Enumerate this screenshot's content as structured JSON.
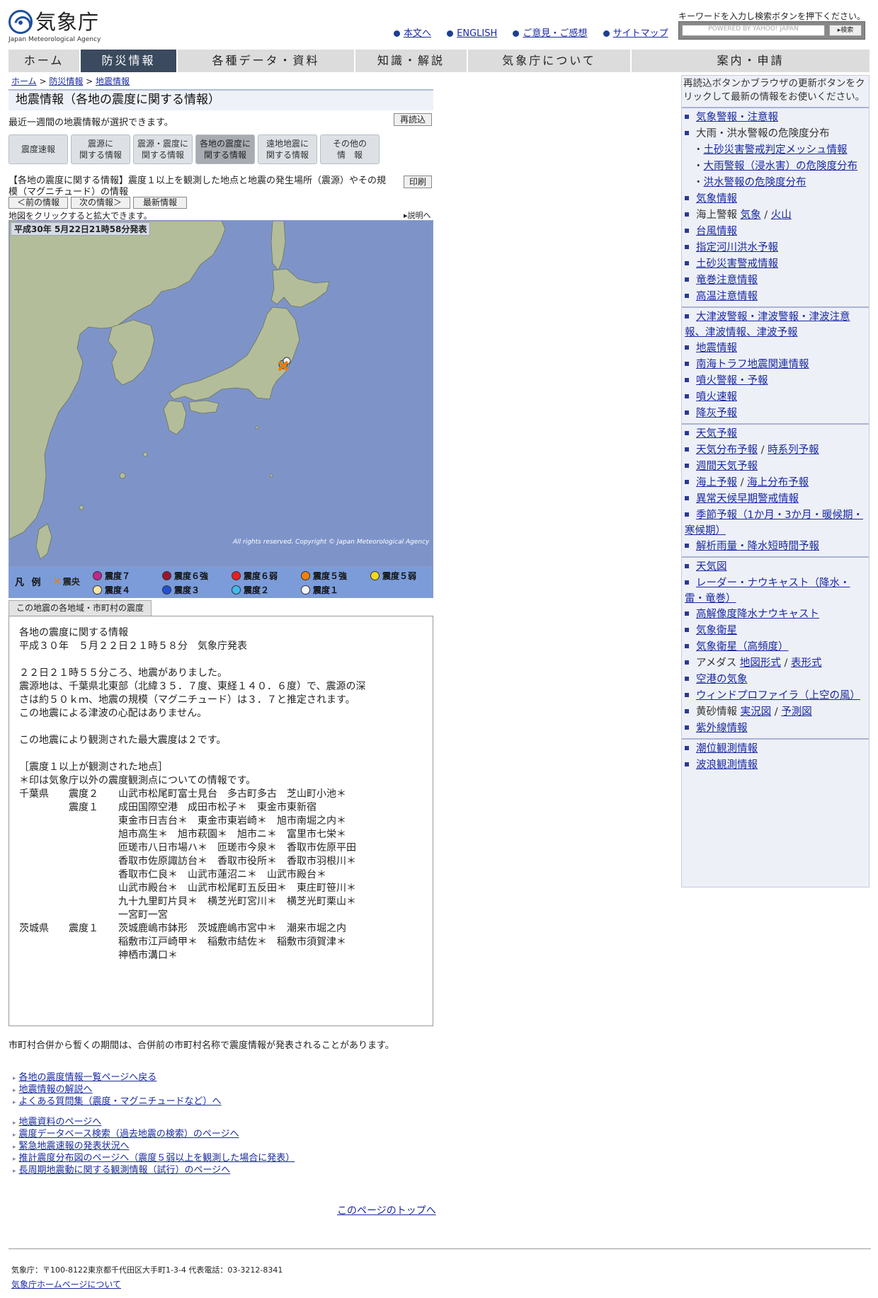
{
  "header": {
    "logo_jp": "気象庁",
    "logo_en": "Japan Meteorological Agency",
    "top_links": [
      "本文へ",
      "ENGLISH",
      "ご意見・ご感想",
      "サイトマップ"
    ],
    "search_hint": "キーワードを入力し検索ボタンを押下ください。",
    "search_placeholder": "POWERED BY YAHOO! JAPAN",
    "search_button": "検索"
  },
  "nav": {
    "tabs": [
      "ホーム",
      "防災情報",
      "各種データ・資料",
      "知識・解説",
      "気象庁について",
      "案内・申請"
    ],
    "active": 1
  },
  "breadcrumb": [
    "ホーム",
    "防災情報",
    "地震情報"
  ],
  "main": {
    "title": "地震情報（各地の震度に関する情報）",
    "lead": "最近一週間の地震情報が選択できます。",
    "reload": "再読込",
    "category_tabs": [
      {
        "l1": "震度速報",
        "l2": ""
      },
      {
        "l1": "震源に",
        "l2": "関する情報"
      },
      {
        "l1": "震源・震度に",
        "l2": "関する情報"
      },
      {
        "l1": "各地の震度に",
        "l2": "関する情報"
      },
      {
        "l1": "遠地地震に",
        "l2": "関する情報"
      },
      {
        "l1": "その他の",
        "l2": "情　報"
      }
    ],
    "info_desc": "【各地の震度に関する情報】震度１以上を観測した地点と地震の発生場所（震源）やその規模（マグニチュード）の情報",
    "print": "印刷",
    "prev": "＜前の情報",
    "next": "次の情報＞",
    "latest": "最新情報",
    "map_hint": "地図をクリックすると拡大できます。",
    "explain": "説明へ",
    "map_date": "平成30年  5月22日21時58分発表",
    "copyright": "All rights reserved. Copyright © Japan Meteorological Agency",
    "legend": {
      "title": "凡 例",
      "epicenter": "震央",
      "items": [
        {
          "label": "震度７",
          "color": "#c0288a"
        },
        {
          "label": "震度６強",
          "color": "#9a1530"
        },
        {
          "label": "震度６弱",
          "color": "#e82020"
        },
        {
          "label": "震度５強",
          "color": "#f08010"
        },
        {
          "label": "震度５弱",
          "color": "#f0d820"
        },
        {
          "label": "震度４",
          "color": "#f5e6a0"
        },
        {
          "label": "震度３",
          "color": "#2050d8"
        },
        {
          "label": "震度２",
          "color": "#40b8f0"
        },
        {
          "label": "震度１",
          "color": "#f4f4f4"
        }
      ]
    },
    "region_tab": "この地震の各地域・市町村の震度",
    "report_lines": [
      "各地の震度に関する情報",
      "平成３０年　５月２２日２１時５８分　気象庁発表",
      "",
      "２２日２１時５５分ころ、地震がありました。",
      "震源地は、千葉県北東部（北緯３５．７度、東経１４０．６度）で、震源の深",
      "さは約５０ｋｍ、地震の規模（マグニチュード）は３．７と推定されます。",
      "この地震による津波の心配はありません。",
      "",
      "この地震により観測された最大震度は２です。",
      "",
      "［震度１以上が観測された地点］",
      "＊印は気象庁以外の震度観測点についての情報です。",
      "千葉県　　震度２　　山武市松尾町富士見台　多古町多古　芝山町小池＊",
      "　　　　　震度１　　成田国際空港　成田市松子＊　東金市東新宿",
      "　　　　　　　　　　東金市日吉台＊　東金市東岩崎＊　旭市南堀之内＊",
      "　　　　　　　　　　旭市高生＊　旭市萩園＊　旭市ニ＊　富里市七栄＊",
      "　　　　　　　　　　匝瑳市八日市場ハ＊　匝瑳市今泉＊　香取市佐原平田",
      "　　　　　　　　　　香取市佐原諏訪台＊　香取市役所＊　香取市羽根川＊",
      "　　　　　　　　　　香取市仁良＊　山武市蓮沼ニ＊　山武市殿台＊",
      "　　　　　　　　　　山武市殿台＊　山武市松尾町五反田＊　東庄町笹川＊",
      "　　　　　　　　　　九十九里町片貝＊　横芝光町宮川＊　横芝光町栗山＊",
      "　　　　　　　　　　一宮町一宮",
      "茨城県　　震度１　　茨城鹿嶋市鉢形　茨城鹿嶋市宮中＊　潮来市堀之内",
      "　　　　　　　　　　稲敷市江戸崎甲＊　稲敷市結佐＊　稲敷市須賀津＊",
      "　　　　　　　　　　神栖市溝口＊"
    ],
    "note": "市町村合併から暫くの期間は、合併前の市町村名称で震度情報が発表されることがあります。",
    "links1": [
      "各地の震度情報一覧ページへ戻る",
      "地震情報の解説へ",
      "よくある質問集（震度・マグニチュードなど）へ"
    ],
    "links2": [
      "地震資料のページへ",
      "震度データベース検索（過去地震の検索）のページへ",
      "緊急地震速報の発表状況へ",
      "推計震度分布図のページへ（震度５弱以上を観測した場合に発表）",
      "長周期地震動に関する観測情報（試行）のページへ"
    ],
    "pagetop": "このページのトップへ"
  },
  "footer": {
    "address": "気象庁：〒100-8122東京都千代田区大手町1-3-4 代表電話：03-3212-8341",
    "link": "気象庁ホームページについて"
  },
  "sidebar": {
    "intro": "再読込ボタンかブラウザの更新ボタンをクリックして最新の情報をお使いください。",
    "groups": [
      [
        {
          "t": "気象警報・注意報",
          "link": true
        },
        {
          "t": "大雨・洪水警報の危険度分布",
          "link": false
        },
        {
          "t": "土砂災害警戒判定メッシュ情報",
          "link": true,
          "sub": true
        },
        {
          "t": "大雨警報（浸水害）の危険度分布",
          "link": true,
          "sub": true
        },
        {
          "t": "洪水警報の危険度分布",
          "link": true,
          "sub": true
        },
        {
          "t": "気象情報",
          "link": true
        },
        {
          "t": "海上警報",
          "link": false,
          "extra": [
            "気象",
            "火山"
          ]
        },
        {
          "t": "台風情報",
          "link": true
        },
        {
          "t": "指定河川洪水予報",
          "link": true
        },
        {
          "t": "土砂災害警戒情報",
          "link": true
        },
        {
          "t": "竜巻注意情報",
          "link": true
        },
        {
          "t": "高温注意情報",
          "link": true
        }
      ],
      [
        {
          "t": "大津波警報・津波警報・津波注意報、津波情報、津波予報",
          "link": true,
          "wrap": true
        },
        {
          "t": "地震情報",
          "link": true
        },
        {
          "t": "南海トラフ地震関連情報",
          "link": true
        },
        {
          "t": "噴火警報・予報",
          "link": true
        },
        {
          "t": "噴火速報",
          "link": true
        },
        {
          "t": "降灰予報",
          "link": true
        }
      ],
      [
        {
          "t": "天気予報",
          "link": true
        },
        {
          "t": "天気分布予報",
          "link": true,
          "extra2": "時系列予報"
        },
        {
          "t": "週間天気予報",
          "link": true
        },
        {
          "t": "海上予報",
          "link": true,
          "extra2": "海上分布予報"
        },
        {
          "t": "異常天候早期警戒情報",
          "link": true
        },
        {
          "t": "季節予報（1か月・3か月・暖候期・寒候期）",
          "link": true,
          "wrap": true
        },
        {
          "t": "解析雨量・降水短時間予報",
          "link": true
        }
      ],
      [
        {
          "t": "天気図",
          "link": true
        },
        {
          "t": "レーダー・ナウキャスト（降水・雷・竜巻）",
          "link": true,
          "wrap": true
        },
        {
          "t": "高解像度降水ナウキャスト",
          "link": true
        },
        {
          "t": "気象衛星",
          "link": true
        },
        {
          "t": "気象衛星（高頻度）",
          "link": true
        },
        {
          "t": "アメダス",
          "link": false,
          "extra": [
            "地図形式",
            "表形式"
          ]
        },
        {
          "t": "空港の気象",
          "link": true
        },
        {
          "t": "ウィンドプロファイラ（上空の風）",
          "link": true
        },
        {
          "t": "黄砂情報",
          "link": false,
          "extra": [
            "実況図",
            "予測図"
          ]
        },
        {
          "t": "紫外線情報",
          "link": true
        }
      ],
      [
        {
          "t": "潮位観測情報",
          "link": true
        },
        {
          "t": "波浪観測情報",
          "link": true
        }
      ]
    ]
  },
  "colors": {
    "nav_active": "#3b4a5e",
    "sea": "#7e94c9",
    "land": "#b4bd9a",
    "link": "#1a2aa0"
  }
}
